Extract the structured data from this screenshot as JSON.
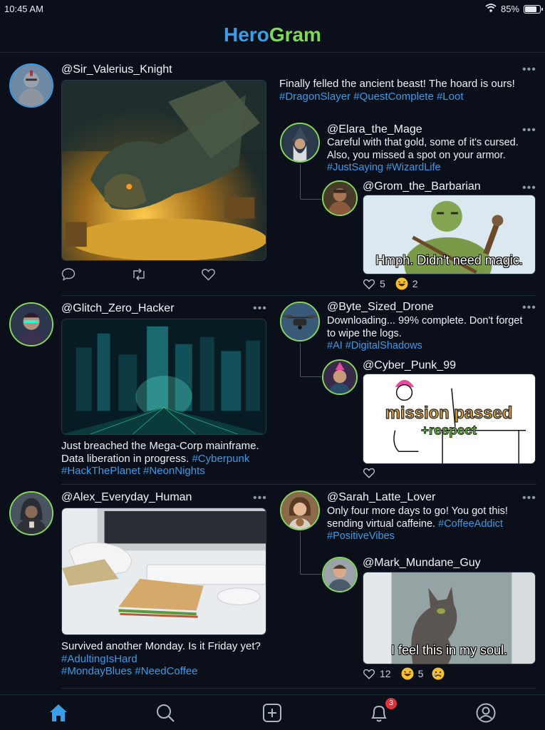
{
  "status": {
    "time": "10:45 AM",
    "battery": "85%",
    "battery_level": 0.85
  },
  "app": {
    "title_part1": "Hero",
    "title_part2": "Gram",
    "brand_blue": "#3a9ee8",
    "brand_green": "#7ed957"
  },
  "posts": [
    {
      "handle": "@Sir_Valerius_Knight",
      "avatar_icon": "knight-avatar",
      "text": "Finally felled the ancient beast! The hoard is ours!",
      "tags": "#DragonSlayer #QuestComplete #Loot",
      "image": "dragon-treasure-image",
      "replies": [
        {
          "handle": "@Elara_the_Mage",
          "avatar_icon": "wizard-avatar",
          "text": "Careful with that gold, some of it's cursed. Also, you missed a spot on your armor.",
          "tags": "#JustSaying #WizardLife"
        },
        {
          "handle": "@Grom_the_Barbarian",
          "avatar_icon": "barbarian-avatar",
          "image": "orc-meme-image",
          "caption": "Hmph. Didn't need magic.",
          "likes": "5",
          "laughs": "2"
        }
      ]
    },
    {
      "handle": "@Glitch_Zero_Hacker",
      "avatar_icon": "hacker-avatar",
      "text": "Just breached the Mega-Corp mainframe. Data liberation in progress.",
      "tags_inline": "#Cyberpunk",
      "tags": "#HackThePlanet #NeonNights",
      "image": "cyber-city-image",
      "replies": [
        {
          "handle": "@Byte_Sized_Drone",
          "avatar_icon": "drone-avatar",
          "text": "Downloading... 99% complete. Don't forget to wipe the logs.",
          "tags": "#AI #DigitalShadows"
        },
        {
          "handle": "@Cyber_Punk_99",
          "avatar_icon": "punk-avatar",
          "image": "mission-passed-meme",
          "caption_line1": "mission passed",
          "caption_line2": "+respect"
        }
      ]
    },
    {
      "handle": "@Alex_Everyday_Human",
      "avatar_icon": "hoodie-avatar",
      "text": "Survived another Monday. Is it Friday yet?",
      "tags_inline": "#AdultingIsHard",
      "tags": "#MondayBlues #NeedCoffee",
      "image": "desk-sandwich-image",
      "replies": [
        {
          "handle": "@Sarah_Latte_Lover",
          "avatar_icon": "latte-avatar",
          "text": "Only four more days to go! You got this! sending virtual caffeine.",
          "tags_inline": "#CoffeeAddict",
          "tags": "#PositiveVibes"
        },
        {
          "handle": "@Mark_Mundane_Guy",
          "avatar_icon": "man-avatar",
          "image": "cat-window-meme",
          "caption": "I feel this in my soul.",
          "likes": "12",
          "laughs": "5"
        }
      ]
    }
  ],
  "more_label": "•••",
  "nav": {
    "items": [
      "home-icon",
      "search-icon",
      "add-post-icon",
      "notifications-icon",
      "profile-icon"
    ],
    "notifications_badge": "3",
    "active": "home-icon",
    "active_color": "#3a9ee8"
  }
}
